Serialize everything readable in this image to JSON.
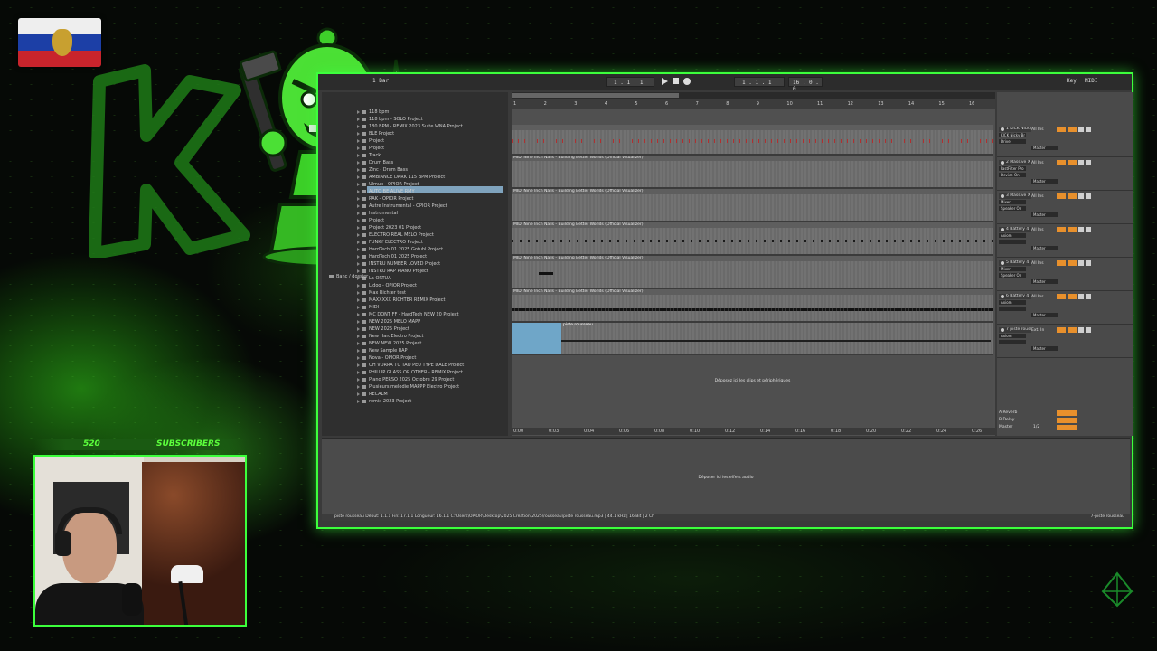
{
  "stream": {
    "subscriber_count": "520",
    "subscriber_label": "SUBSCRIBERS"
  },
  "daw": {
    "transport": {
      "tempo": "1 Bar",
      "position_1": "1 . 1 . 1",
      "position_2": "1 . 1 . 1",
      "end_position": "16 . 0 . 0",
      "key_label": "Key",
      "midi_label": "MIDI"
    },
    "browser_items": [
      "118 bpm",
      "118 bpm - SOLO Project",
      "180 BPM - REMIX 2023 Suite WNA Project",
      "BLE Project",
      "Project",
      "Project",
      "Track",
      "Drum Bass",
      "Zinc - Drum Bass",
      "AMBIANCE DARK 115 BPM Project",
      "Ulmux - OPIOR Project",
      "AUTO BE ALIVE RMY",
      "RAK - OPIOR Project",
      "Autre Instrumental - OPIOR Project",
      "Instrumental",
      "Project",
      "Project 2023 01 Project",
      "ELECTRO REAL MELO Project",
      "FUNKY ELECTRO Project",
      "HardTech 01 2025 Gofuhl Project",
      "HardTech 01 2025 Project",
      "INSTRU NUMBER LOVED Project",
      "INSTRU RAP PIANO Project",
      "La ORTUA",
      "Lidoo - OPIOR Project",
      "Max Richter test",
      "MAXXXXX RICHTER REMIX Project",
      "MIDI",
      "MC DONT FF - HardTech NEW 20 Project",
      "NEW 2025 MELO MAPP",
      "NEW 2025 Project",
      "New HardElectro Project",
      "NEW NEW 2025 Project",
      "New Sample RAP",
      "Nova - OPIOR Project",
      "OH VORRA TU TAO PEU TYPE DALE Project",
      "PHILLIP GLASS OR OTHER - REMIX Project",
      "Piano PERSO 2025 Octobre 29 Project",
      "Plusieurs melodie MAPPP Electro Project",
      "RECALM",
      "remix 2023 Project"
    ],
    "bottom_browser_label": "Banc / dossier",
    "ruler_ticks": [
      "1",
      "2",
      "3",
      "4",
      "5",
      "6",
      "7",
      "8",
      "9",
      "10",
      "11",
      "12",
      "13",
      "14",
      "15",
      "16",
      "17"
    ],
    "time_ticks": [
      "0:00",
      "0:03",
      "0:04",
      "0:06",
      "0:08",
      "0:10",
      "0:12",
      "0:14",
      "0:16",
      "0:18",
      "0:20",
      "0:22",
      "0:24",
      "0:26",
      "0:28"
    ],
    "clip_name": "MIDI Nine Inch Nails - Building Better Worlds (Official Visualizer)",
    "audio_clip_name": "piste rousseau",
    "drop_clips_text": "Déposez ici les clips et périphériques",
    "drop_effects_text": "Déposer ici les effets audio",
    "tracks": [
      {
        "name": "1 KICK Nicky",
        "input": "All Ins",
        "device": "KICK Nicky Br",
        "chain": "Drive",
        "out": "Master"
      },
      {
        "name": "2 Massive X",
        "input": "All Ins",
        "device": "FastFilter Pro",
        "chain": "Device On",
        "out": "Master"
      },
      {
        "name": "3 Massive X",
        "input": "All Ins",
        "device": "Mixer",
        "chain": "Speaker On",
        "out": "Master"
      },
      {
        "name": "4 Battery 4",
        "input": "All Ins",
        "device": "Axiom",
        "chain": "",
        "out": "Master"
      },
      {
        "name": "5 Battery 4",
        "input": "All Ins",
        "device": "Mixer",
        "chain": "Speaker On",
        "out": "Master"
      },
      {
        "name": "6 Battery 4",
        "input": "All Ins",
        "device": "Axiom",
        "chain": "",
        "out": "Master"
      },
      {
        "name": "7 piste rouss",
        "input": "Ext. In",
        "device": "Axiom",
        "chain": "",
        "out": "Master"
      }
    ],
    "returns": [
      {
        "name": "A Reverb"
      },
      {
        "name": "B Delay"
      },
      {
        "name": "Master",
        "ratio": "1/2"
      }
    ],
    "status_left": "piste rousseau  Début: 1.1.1  Fin: 17.1.1  Longueur: 16.1.1  C:\\Users\\OPIOR\\Desktop\\2025 Création\\2025\\rousseau\\piste rousseau.mp3  |  44.1 kHz  |  16 Bit  |  2 Ch",
    "status_right": "7-piste rousseau"
  },
  "colors": {
    "accent": "#3cff3c",
    "clip_blue": "#6fa6c8",
    "orange": "#e8902c"
  }
}
